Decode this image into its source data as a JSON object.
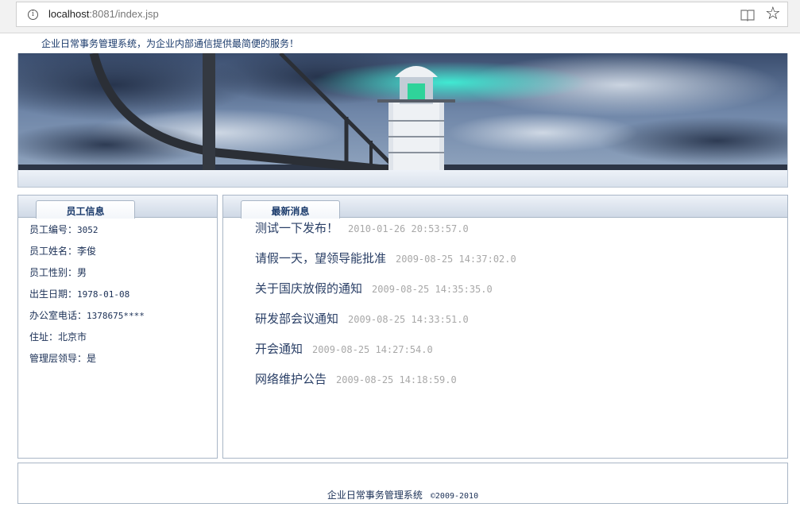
{
  "browser": {
    "url_host": "localhost",
    "url_rest": ":8081/index.jsp"
  },
  "header": {
    "tagline": "企业日常事务管理系统，为企业内部通信提供最简便的服务！"
  },
  "employee_panel": {
    "tab_title": "员工信息",
    "fields": [
      {
        "label": "员工编号：",
        "value": "3052"
      },
      {
        "label": "员工姓名：",
        "value": "李俊"
      },
      {
        "label": "员工性别：",
        "value": "男"
      },
      {
        "label": "出生日期：",
        "value": "1978-01-08"
      },
      {
        "label": "办公室电话：",
        "value": "1378675****"
      },
      {
        "label": "住址：",
        "value": "北京市"
      },
      {
        "label": "管理层领导：",
        "value": "是"
      }
    ]
  },
  "news_panel": {
    "tab_title": "最新消息",
    "items": [
      {
        "title": "测试一下发布！",
        "date": "2010-01-26 20:53:57.0"
      },
      {
        "title": "请假一天，望领导能批准",
        "date": "2009-08-25 14:37:02.0"
      },
      {
        "title": "关于国庆放假的通知",
        "date": "2009-08-25 14:35:35.0"
      },
      {
        "title": "研发部会议通知",
        "date": "2009-08-25 14:33:51.0"
      },
      {
        "title": "开会通知",
        "date": "2009-08-25 14:27:54.0"
      },
      {
        "title": "网络维护公告",
        "date": "2009-08-25 14:18:59.0"
      }
    ]
  },
  "footer": {
    "system_name": "企业日常事务管理系统",
    "copyright": "©2009-2010"
  }
}
